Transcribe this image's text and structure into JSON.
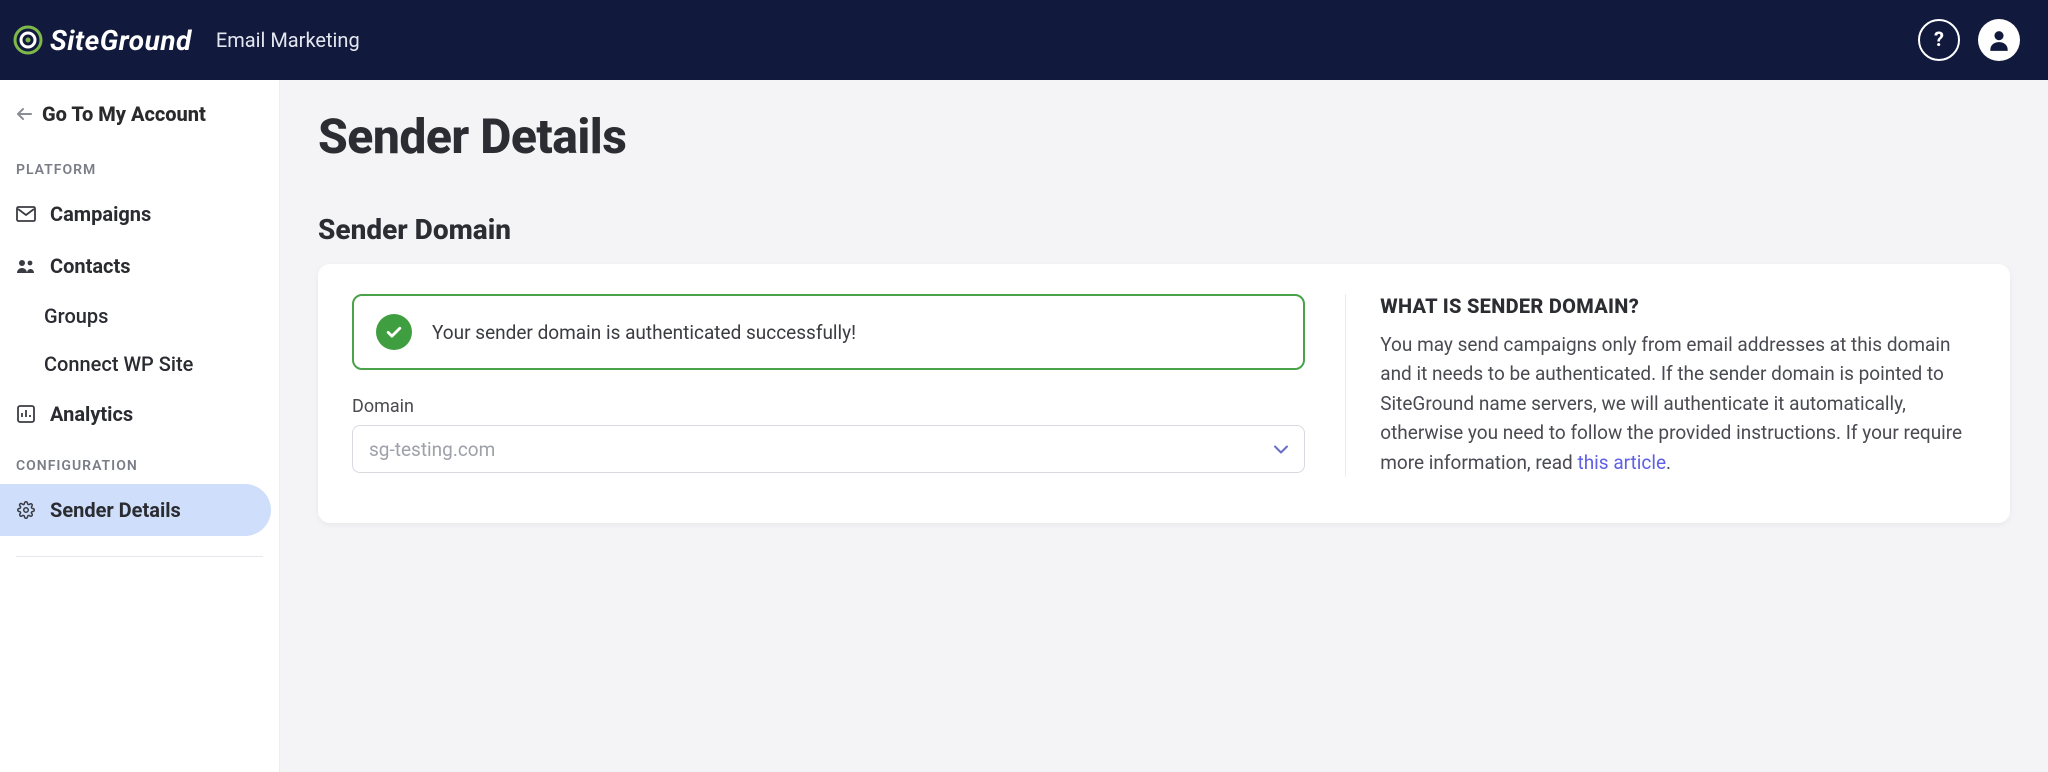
{
  "header": {
    "brand": "SiteGround",
    "product": "Email Marketing"
  },
  "sidebar": {
    "back_label": "Go To My Account",
    "section_platform": "PLATFORM",
    "section_configuration": "CONFIGURATION",
    "items": {
      "campaigns": "Campaigns",
      "contacts": "Contacts",
      "groups": "Groups",
      "connect_wp": "Connect WP Site",
      "analytics": "Analytics",
      "sender_details": "Sender Details"
    }
  },
  "page": {
    "title": "Sender Details",
    "section_title": "Sender Domain"
  },
  "alert": {
    "success_message": "Your sender domain is authenticated successfully!"
  },
  "domain_field": {
    "label": "Domain",
    "value": "sg-testing.com"
  },
  "info": {
    "heading": "WHAT IS SENDER DOMAIN?",
    "body_pre": "You may send campaigns only from email addresses at this domain and it needs to be authenticated. If the sender domain is pointed to SiteGround name servers, we will authenticate it automatically, otherwise you need to follow the provided instructions. If your require more information, read ",
    "link_text": "this article",
    "body_post": "."
  }
}
